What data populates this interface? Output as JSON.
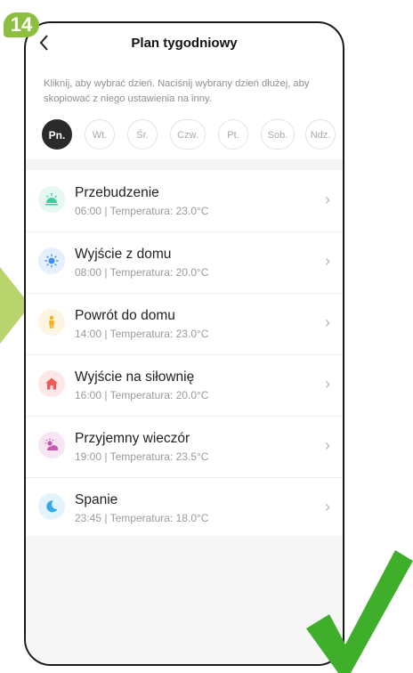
{
  "step_badge": "14",
  "header": {
    "back_icon": "chevron-left-icon",
    "title": "Plan tygodniowy"
  },
  "hint": "Kliknij, aby wybrać dzień. Naciśnij wybrany dzień dłużej, aby skopiować z niego ustawienia na inny.",
  "days": [
    {
      "label": "Pn.",
      "active": true
    },
    {
      "label": "Wt.",
      "active": false
    },
    {
      "label": "Śr.",
      "active": false
    },
    {
      "label": "Czw.",
      "active": false
    },
    {
      "label": "Pt.",
      "active": false
    },
    {
      "label": "Sob.",
      "active": false
    },
    {
      "label": "Ndz.",
      "active": false
    }
  ],
  "schedule": [
    {
      "title": "Przebudzenie",
      "subtitle": "06:00 | Temperatura: 23.0°C",
      "icon": "sunrise-icon",
      "icon_color": "#3ccfa0",
      "icon_bg": "#e5f8f1"
    },
    {
      "title": "Wyjście z domu",
      "subtitle": "08:00 | Temperatura: 20.0°C",
      "icon": "sun-icon",
      "icon_color": "#3f8ff0",
      "icon_bg": "#e6f0fd"
    },
    {
      "title": "Powrót do domu",
      "subtitle": "14:00 | Temperatura: 23.0°C",
      "icon": "person-icon",
      "icon_color": "#f3b224",
      "icon_bg": "#fdf4e1"
    },
    {
      "title": "Wyjście na siłownię",
      "subtitle": "16:00 | Temperatura: 20.0°C",
      "icon": "home-icon",
      "icon_color": "#ef5a5a",
      "icon_bg": "#fde7e7"
    },
    {
      "title": "Przyjemny wieczór",
      "subtitle": "19:00 | Temperatura: 23.5°C",
      "icon": "sunset-icon",
      "icon_color": "#c25ab0",
      "icon_bg": "#f7e5f3"
    },
    {
      "title": "Spanie",
      "subtitle": "23:45 | Temperatura: 18.0°C",
      "icon": "moon-icon",
      "icon_color": "#36a9e8",
      "icon_bg": "#e3f3fc"
    }
  ],
  "colors": {
    "badge": "#8cbf3f",
    "check": "#3fae2a",
    "arrow": "#b8d56d"
  }
}
